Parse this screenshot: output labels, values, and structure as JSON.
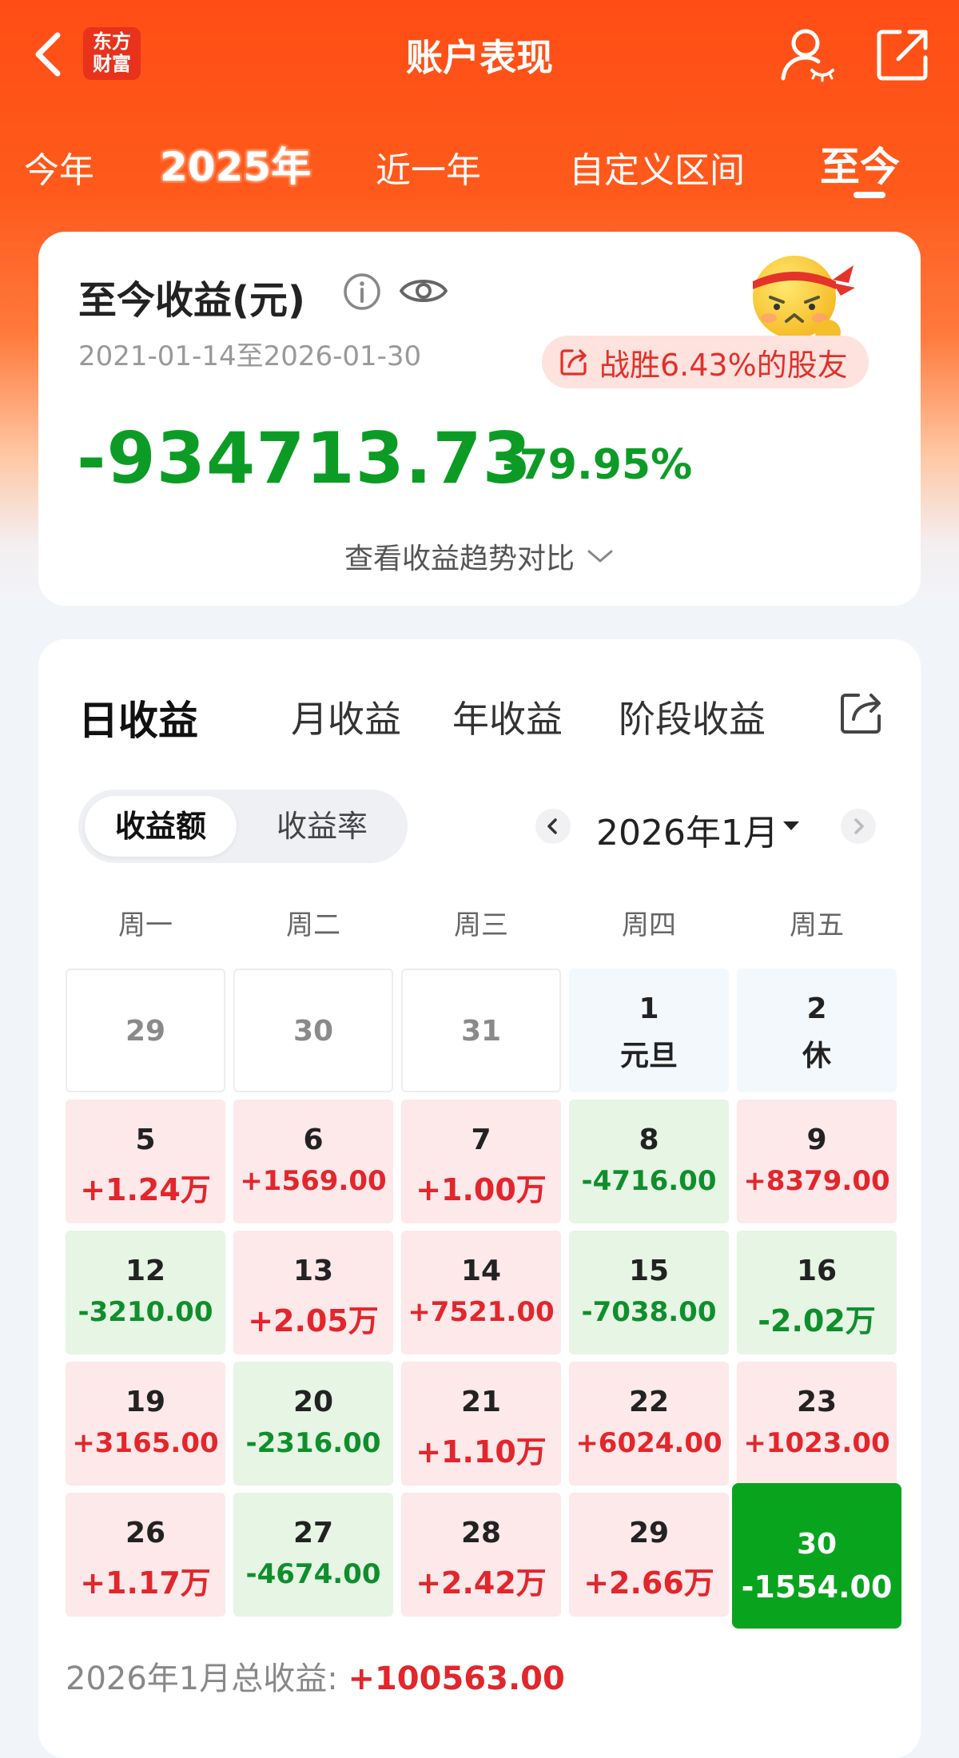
{
  "header": {
    "title": "账户表现",
    "logo_line1": "东方",
    "logo_line2": "财富"
  },
  "period_tabs": [
    {
      "label": "今年"
    },
    {
      "label": "2025年"
    },
    {
      "label": "近一年"
    },
    {
      "label": "自定义区间"
    },
    {
      "label": "至今",
      "active": true
    }
  ],
  "summary": {
    "label": "至今收益(元)",
    "date_range": "2021-01-14至2026-01-30",
    "beat_text": "战胜6.43%的股友",
    "amount": "-934713.73",
    "percent": "-79.95%",
    "trend_link": "查看收益趋势对比"
  },
  "granularity_tabs": [
    {
      "label": "日收益",
      "active": true
    },
    {
      "label": "月收益"
    },
    {
      "label": "年收益"
    },
    {
      "label": "阶段收益"
    }
  ],
  "segment": {
    "items": [
      {
        "label": "收益额",
        "active": true
      },
      {
        "label": "收益率"
      }
    ]
  },
  "month": {
    "label": "2026年1月"
  },
  "weekdays": [
    "周一",
    "周二",
    "周三",
    "周四",
    "周五"
  ],
  "calendar_rows": [
    [
      {
        "day": "29",
        "value": "",
        "kind": "prev"
      },
      {
        "day": "30",
        "value": "",
        "kind": "prev"
      },
      {
        "day": "31",
        "value": "",
        "kind": "prev"
      },
      {
        "day": "1",
        "value": "元旦",
        "kind": "holiday"
      },
      {
        "day": "2",
        "value": "休",
        "kind": "holiday"
      }
    ],
    [
      {
        "day": "5",
        "value": "+1.24万",
        "kind": "up"
      },
      {
        "day": "6",
        "value": "+1569.00",
        "kind": "up"
      },
      {
        "day": "7",
        "value": "+1.00万",
        "kind": "up"
      },
      {
        "day": "8",
        "value": "-4716.00",
        "kind": "down"
      },
      {
        "day": "9",
        "value": "+8379.00",
        "kind": "up"
      }
    ],
    [
      {
        "day": "12",
        "value": "-3210.00",
        "kind": "down"
      },
      {
        "day": "13",
        "value": "+2.05万",
        "kind": "up"
      },
      {
        "day": "14",
        "value": "+7521.00",
        "kind": "up"
      },
      {
        "day": "15",
        "value": "-7038.00",
        "kind": "down"
      },
      {
        "day": "16",
        "value": "-2.02万",
        "kind": "down"
      }
    ],
    [
      {
        "day": "19",
        "value": "+3165.00",
        "kind": "up"
      },
      {
        "day": "20",
        "value": "-2316.00",
        "kind": "down"
      },
      {
        "day": "21",
        "value": "+1.10万",
        "kind": "up"
      },
      {
        "day": "22",
        "value": "+6024.00",
        "kind": "up"
      },
      {
        "day": "23",
        "value": "+1023.00",
        "kind": "up"
      }
    ],
    [
      {
        "day": "26",
        "value": "+1.17万",
        "kind": "up"
      },
      {
        "day": "27",
        "value": "-4674.00",
        "kind": "down"
      },
      {
        "day": "28",
        "value": "+2.42万",
        "kind": "up"
      },
      {
        "day": "29",
        "value": "+2.66万",
        "kind": "up"
      },
      {
        "day": "30",
        "value": "-1554.00",
        "kind": "sel"
      }
    ]
  ],
  "total": {
    "label": "2026年1月总收益:",
    "value": "+100563.00"
  },
  "colors": {
    "header_orange": "#ff4d15",
    "profit_red": "#e2262b",
    "loss_green": "#0c9c26",
    "selected_green": "#09a41e"
  },
  "icons": [
    "back-arrow-icon",
    "user-icon",
    "share-icon",
    "info-icon",
    "eye-icon",
    "mascot-icon",
    "share-small-icon",
    "chevron-down-icon",
    "export-icon",
    "chevron-left-icon",
    "chevron-right-icon",
    "caret-down-icon"
  ]
}
